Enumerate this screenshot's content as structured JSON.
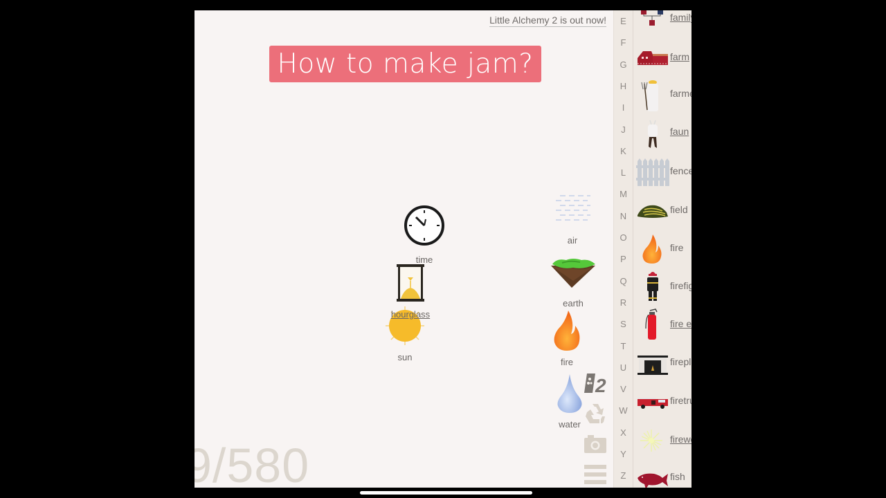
{
  "promo_link": "Little Alchemy 2 is out now!",
  "question": "How to make jam?",
  "counter": "9/580",
  "workspace_elements": [
    {
      "name": "time",
      "icon": "clock-icon"
    },
    {
      "name": "hourglass",
      "icon": "hourglass-icon",
      "underlined": true
    },
    {
      "name": "sun",
      "icon": "sun-icon"
    },
    {
      "name": "air",
      "icon": "air-icon"
    },
    {
      "name": "earth",
      "icon": "earth-icon"
    },
    {
      "name": "fire",
      "icon": "fire-icon"
    },
    {
      "name": "water",
      "icon": "water-drop-icon"
    }
  ],
  "tools": [
    {
      "name": "little-alchemy-2",
      "icon": "la2-logo-icon"
    },
    {
      "name": "recycle",
      "icon": "recycle-icon"
    },
    {
      "name": "screenshot",
      "icon": "camera-icon"
    },
    {
      "name": "menu",
      "icon": "hamburger-menu-icon"
    }
  ],
  "alphabet": [
    "E",
    "F",
    "G",
    "H",
    "I",
    "J",
    "K",
    "L",
    "M",
    "N",
    "O",
    "P",
    "Q",
    "R",
    "S",
    "T",
    "U",
    "V",
    "W",
    "X",
    "Y",
    "Z"
  ],
  "library": [
    {
      "label": "family",
      "underlined": true,
      "icon": "family-icon"
    },
    {
      "label": "farm",
      "underlined": true,
      "icon": "barn-icon"
    },
    {
      "label": "farmer",
      "underlined": false,
      "icon": "farmer-icon"
    },
    {
      "label": "faun",
      "underlined": true,
      "icon": "faun-icon"
    },
    {
      "label": "fence",
      "underlined": false,
      "icon": "fence-icon"
    },
    {
      "label": "field",
      "underlined": false,
      "icon": "field-icon"
    },
    {
      "label": "fire",
      "underlined": false,
      "icon": "fire-icon"
    },
    {
      "label": "firefighter",
      "underlined": false,
      "icon": "firefighter-icon"
    },
    {
      "label": "fire extinguisher",
      "underlined": true,
      "icon": "fire-extinguisher-icon"
    },
    {
      "label": "fireplace",
      "underlined": false,
      "icon": "fireplace-icon"
    },
    {
      "label": "firetruck",
      "underlined": false,
      "icon": "firetruck-icon"
    },
    {
      "label": "firework",
      "underlined": true,
      "icon": "firework-icon"
    },
    {
      "label": "fish",
      "underlined": false,
      "icon": "fish-icon"
    }
  ]
}
